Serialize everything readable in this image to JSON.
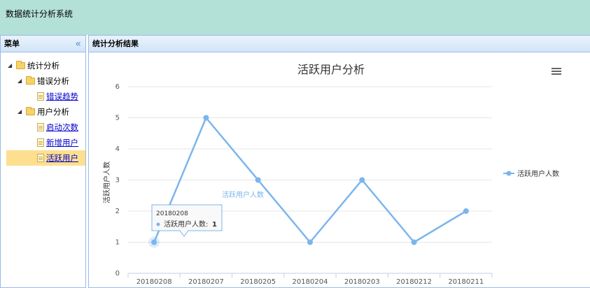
{
  "app": {
    "title": "数据统计分析系统"
  },
  "sidebar": {
    "title": "菜单",
    "collapse": "«",
    "tree": {
      "root": "统计分析",
      "groups": [
        {
          "label": "错误分析",
          "items": [
            "错误趋势"
          ]
        },
        {
          "label": "用户分析",
          "items": [
            "启动次数",
            "新增用户",
            "活跃用户"
          ]
        }
      ]
    }
  },
  "main": {
    "title": "统计分析结果"
  },
  "chart_data": {
    "type": "line",
    "title": "活跃用户分析",
    "ylabel": "活跃用户人数",
    "xlabel": "",
    "categories": [
      "20180208",
      "20180207",
      "20180205",
      "20180204",
      "20180203",
      "20180212",
      "20180211"
    ],
    "series": [
      {
        "name": "活跃用户人数",
        "values": [
          1,
          5,
          3,
          1,
          3,
          1,
          2
        ]
      }
    ],
    "ylim": [
      0,
      6
    ],
    "yticks": [
      "0",
      "1",
      "2",
      "3",
      "4",
      "5",
      "6"
    ],
    "grid": true,
    "legend": "right",
    "inline_label": "活跃用户人数",
    "tooltip": {
      "header": "20180208",
      "label": "活跃用户人数:",
      "value": "1"
    },
    "menu_icon": "hamburger-menu-icon",
    "color": "#7cb5ec"
  }
}
